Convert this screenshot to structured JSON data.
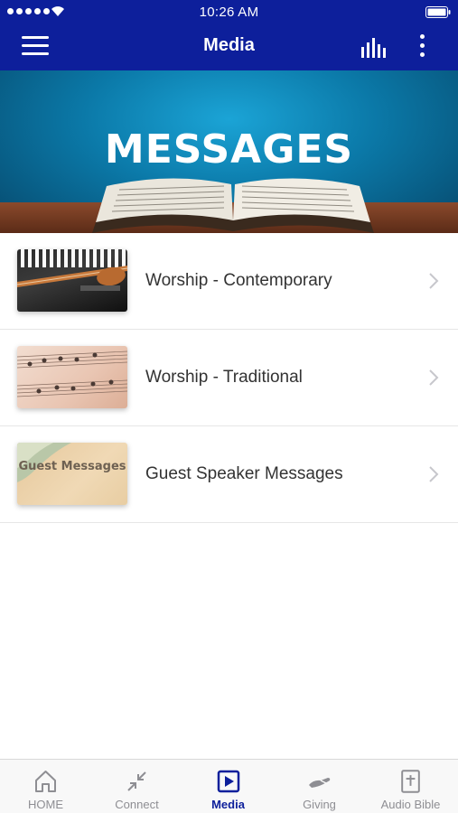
{
  "status_bar": {
    "time": "10:26 AM"
  },
  "nav": {
    "title": "Media"
  },
  "banner": {
    "title": "MESSAGES"
  },
  "list": {
    "items": [
      {
        "label": "Worship - Contemporary"
      },
      {
        "label": "Worship - Traditional"
      },
      {
        "label": "Guest Speaker Messages",
        "thumb_text": "Guest Messages"
      }
    ]
  },
  "tabbar": {
    "tabs": [
      {
        "label": "HOME",
        "icon": "home-icon"
      },
      {
        "label": "Connect",
        "icon": "connect-arrows-icon"
      },
      {
        "label": "Media",
        "icon": "play-icon"
      },
      {
        "label": "Giving",
        "icon": "giving-hand-icon"
      },
      {
        "label": "Audio Bible",
        "icon": "bible-icon"
      }
    ],
    "active": "Media"
  },
  "colors": {
    "brand": "#0d1f9b",
    "tab_inactive": "#8e8e93",
    "text": "#333333",
    "divider": "#e6e6e6"
  }
}
